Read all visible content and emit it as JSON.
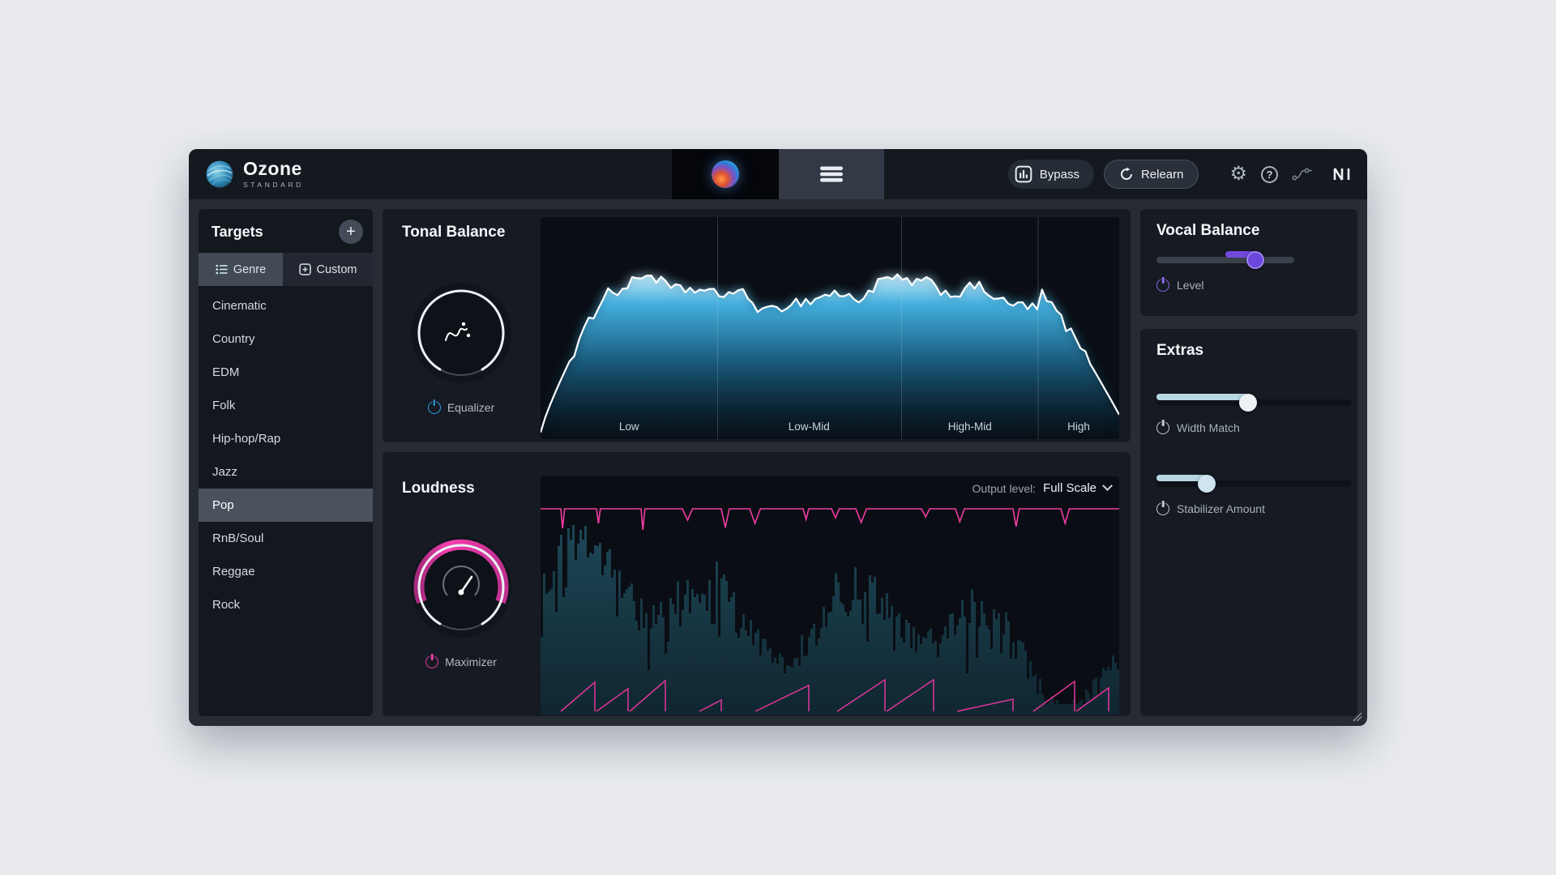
{
  "app": {
    "name": "Ozone",
    "edition": "STANDARD"
  },
  "topbar": {
    "bypass_label": "Bypass",
    "relearn_label": "Relearn"
  },
  "icons": {
    "gear": "⚙",
    "help": "?"
  },
  "sidebar": {
    "title": "Targets",
    "add_label": "+",
    "tabs": [
      {
        "label": "Genre"
      },
      {
        "label": "Custom"
      }
    ],
    "active_tab": "Genre",
    "genres": [
      "Cinematic",
      "Country",
      "EDM",
      "Folk",
      "Hip-hop/Rap",
      "Jazz",
      "Pop",
      "RnB/Soul",
      "Reggae",
      "Rock"
    ],
    "selected_genre": "Pop"
  },
  "tonal": {
    "title": "Tonal Balance",
    "knob_label": "Equalizer",
    "bands": [
      "Low",
      "Low-Mid",
      "High-Mid",
      "High"
    ]
  },
  "loudness": {
    "title": "Loudness",
    "knob_label": "Maximizer",
    "output_level_label": "Output level:",
    "output_level_value": "Full Scale"
  },
  "vocal": {
    "title": "Vocal Balance",
    "slider_label": "Level",
    "value_pct": 72,
    "fill_from_pct": 50
  },
  "extras": {
    "title": "Extras",
    "sliders": [
      {
        "label": "Width Match",
        "value_pct": 47
      },
      {
        "label": "Stabilizer Amount",
        "value_pct": 26
      }
    ]
  },
  "colors": {
    "accent_blue": "#41b5e6",
    "magenta": "#e83fa8",
    "purple": "#7352dc",
    "pale_blue": "#b7d8e3",
    "panel_bg": "#161a22",
    "display_bg": "#0a0e14"
  }
}
